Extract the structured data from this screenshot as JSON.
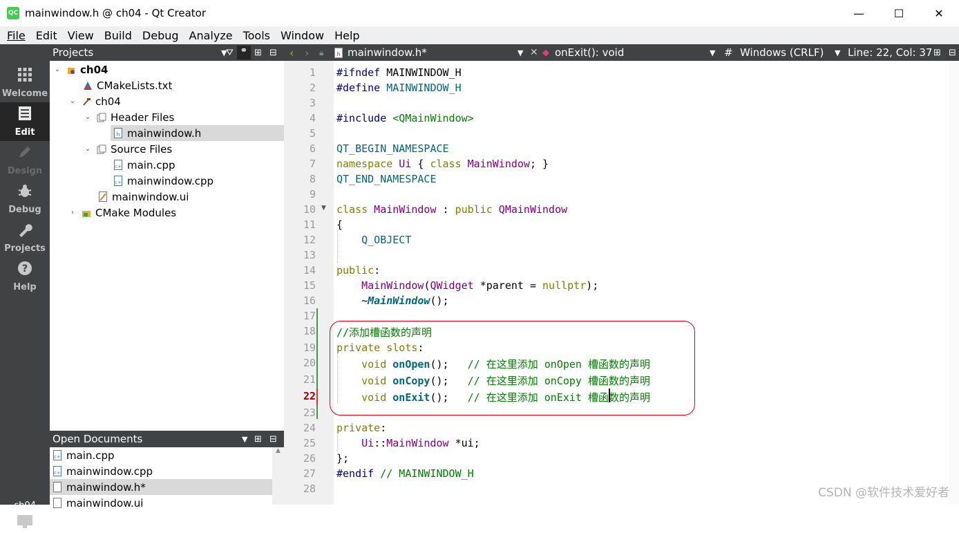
{
  "window": {
    "title": "mainwindow.h @ ch04 - Qt Creator",
    "app_icon": "QC",
    "buttons": [
      "—",
      "☐",
      "✕"
    ]
  },
  "menu": [
    "File",
    "Edit",
    "View",
    "Build",
    "Debug",
    "Analyze",
    "Tools",
    "Window",
    "Help"
  ],
  "modes": [
    {
      "label": "Welcome",
      "icon": "grid-icon"
    },
    {
      "label": "Edit",
      "icon": "document-icon"
    },
    {
      "label": "Design",
      "icon": "pencil-icon"
    },
    {
      "label": "Debug",
      "icon": "bug-icon"
    },
    {
      "label": "Projects",
      "icon": "wrench-icon"
    },
    {
      "label": "Help",
      "icon": "help-icon"
    }
  ],
  "kit": {
    "label": "ch04",
    "icon": "monitor-icon"
  },
  "projects": {
    "title": "Projects",
    "tree": [
      {
        "label": "ch04"
      },
      {
        "label": "CMakeLists.txt"
      },
      {
        "label": "ch04"
      },
      {
        "label": "Header Files"
      },
      {
        "label": "mainwindow.h"
      },
      {
        "label": "Source Files"
      },
      {
        "label": "main.cpp"
      },
      {
        "label": "mainwindow.cpp"
      },
      {
        "label": "mainwindow.ui"
      },
      {
        "label": "CMake Modules"
      }
    ]
  },
  "open_documents": {
    "title": "Open Documents",
    "items": [
      "main.cpp",
      "mainwindow.cpp",
      "mainwindow.h*",
      "mainwindow.ui"
    ]
  },
  "editor": {
    "file": "mainwindow.h*",
    "symbol": "onExit(): void",
    "encoding_hash": "#",
    "line_endings": "Windows (CRLF)",
    "cursor": "Line: 22, Col: 37"
  },
  "line_numbers": [
    "1",
    "2",
    "3",
    "4",
    "5",
    "6",
    "7",
    "8",
    "9",
    "10",
    "11",
    "12",
    "13",
    "14",
    "15",
    "16",
    "17",
    "18",
    "19",
    "20",
    "21",
    "22",
    "23",
    "24",
    "25",
    "26",
    "27",
    "28"
  ],
  "code": {
    "l1a": "#ifndef",
    "l1b": " MAINWINDOW_H",
    "l2a": "#define",
    "l2b": " MAINWINDOW_H",
    "l4a": "#include",
    "l4b": " <QMainWindow>",
    "l6": "QT_BEGIN_NAMESPACE",
    "l7a": "namespace",
    "l7b": " Ui",
    "l7c": " { ",
    "l7d": "class",
    "l7e": " MainWindow",
    "l7f": "; }",
    "l8": "QT_END_NAMESPACE",
    "l10a": "class",
    "l10b": " MainWindow",
    "l10c": " : ",
    "l10d": "public",
    "l10e": " QMainWindow",
    "l11": "{",
    "l12": "    Q_OBJECT",
    "l14a": "public",
    "l14b": ":",
    "l15a": "    MainWindow",
    "l15b": "(",
    "l15c": "QWidget",
    "l15d": " *parent = ",
    "l15e": "nullptr",
    "l15f": ");",
    "l16a": "    ~",
    "l16b": "MainWindow",
    "l16c": "();",
    "l18": "//添加槽函数的声明",
    "l19a": "private slots",
    "l19b": ":",
    "l20a": "    void ",
    "l20b": "onOpen",
    "l20c": "();   ",
    "l20d": "// 在这里添加 onOpen 槽函数的声明",
    "l21a": "    void ",
    "l21b": "onCopy",
    "l21c": "();   ",
    "l21d": "// 在这里添加 onCopy 槽函数的声明",
    "l22a": "    void ",
    "l22b": "onExit",
    "l22c": "();   ",
    "l22d": "// 在这里添加 onExit 槽函数的声明",
    "l24a": "private",
    "l24b": ":",
    "l25a": "    Ui",
    "l25b": "::",
    "l25c": "MainWindow",
    "l25d": " *ui;",
    "l26": "};",
    "l27a": "#endif",
    "l27b": " // MAINWINDOW_H"
  },
  "current_line": "22",
  "watermark": "CSDN @软件技术爱好者"
}
